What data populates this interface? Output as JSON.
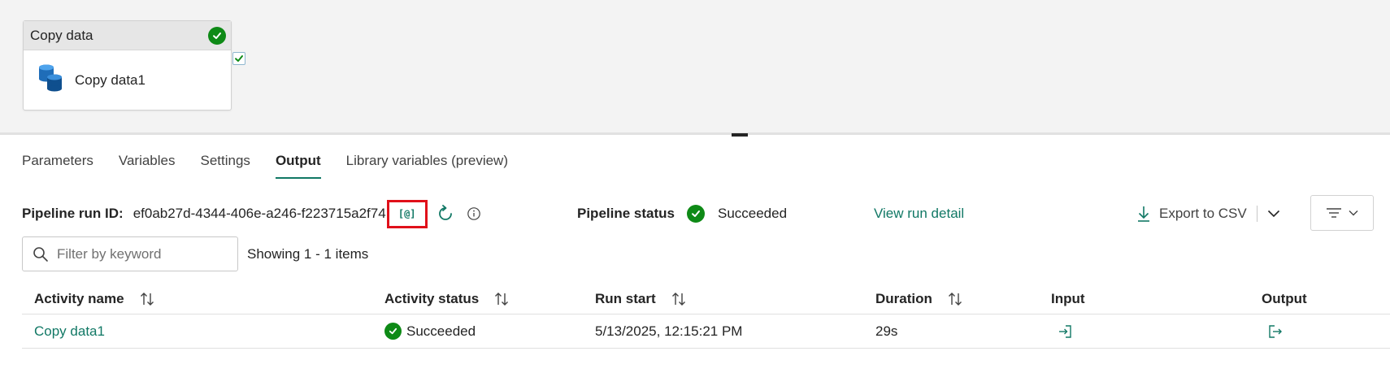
{
  "canvas": {
    "activity_group": "Copy data",
    "activity_name": "Copy data1"
  },
  "tabs": [
    {
      "label": "Parameters"
    },
    {
      "label": "Variables"
    },
    {
      "label": "Settings"
    },
    {
      "label": "Output",
      "active": true
    },
    {
      "label": "Library variables (preview)"
    }
  ],
  "run": {
    "id_label": "Pipeline run ID:",
    "id_value": "ef0ab27d-4344-406e-a246-f223715a2f74",
    "copy_glyph": "[@]",
    "status_label": "Pipeline status",
    "status_value": "Succeeded",
    "view_detail": "View run detail",
    "export_label": "Export to CSV"
  },
  "search": {
    "placeholder": "Filter by keyword",
    "showing": "Showing 1 - 1 items"
  },
  "table": {
    "columns": [
      "Activity name",
      "Activity status",
      "Run start",
      "Duration",
      "Input",
      "Output"
    ],
    "rows": [
      {
        "activity_name": "Copy data1",
        "status": "Succeeded",
        "run_start": "5/13/2025, 12:15:21 PM",
        "duration": "29s"
      }
    ]
  },
  "colors": {
    "accent": "#117865",
    "success": "#0e8a16",
    "highlight_box": "#e0101a"
  }
}
